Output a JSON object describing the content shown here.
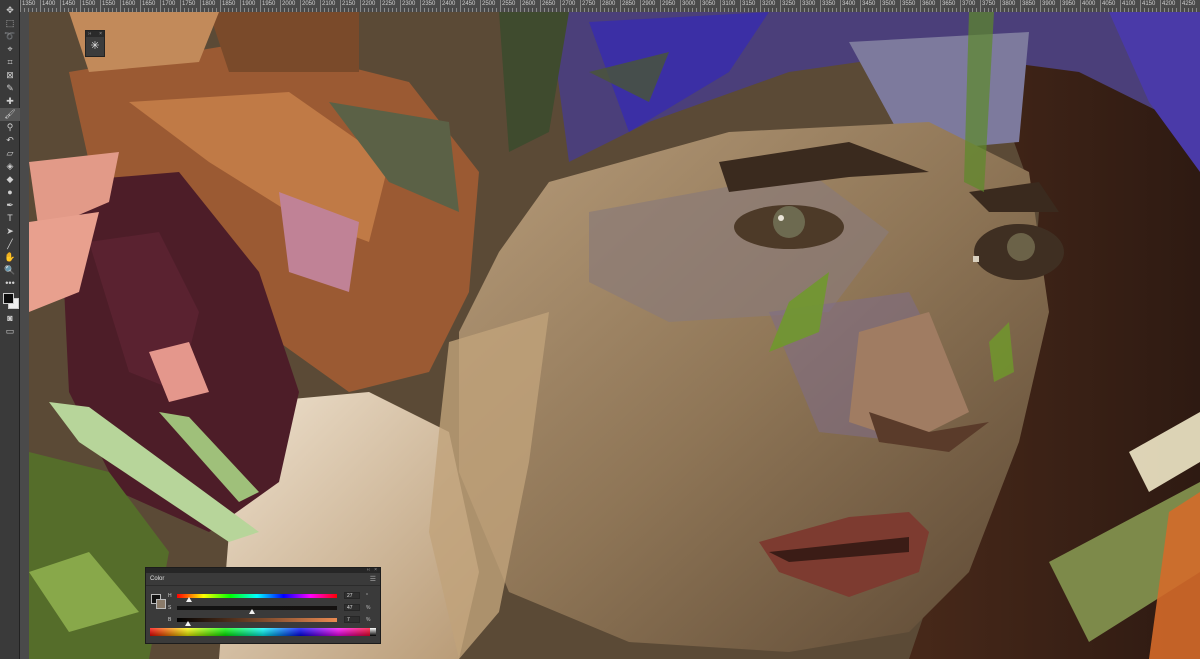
{
  "ruler": {
    "labels": [
      "1350",
      "1400",
      "1450",
      "1500",
      "1550",
      "1600",
      "1650",
      "1700",
      "1750",
      "1800",
      "1850",
      "1900",
      "1950",
      "2000",
      "2050",
      "2100",
      "2150",
      "2200",
      "2250",
      "2300",
      "2350",
      "2400",
      "2450",
      "2500",
      "2550",
      "2600",
      "2650",
      "2700",
      "2750",
      "2800",
      "2850",
      "2900",
      "2950",
      "3000",
      "3050",
      "3100",
      "3150",
      "3200",
      "3250",
      "3300",
      "3350",
      "3400",
      "3450",
      "3500",
      "3550",
      "3600",
      "3650",
      "3700",
      "3750",
      "3800",
      "3850",
      "3900",
      "3950",
      "4000",
      "4050",
      "4100",
      "4150",
      "4200",
      "4250"
    ]
  },
  "toolbar": {
    "tools": [
      {
        "name": "move-tool-icon",
        "glyph": "✥"
      },
      {
        "name": "marquee-tool-icon",
        "glyph": "⬚"
      },
      {
        "name": "lasso-tool-icon",
        "glyph": "➰"
      },
      {
        "name": "quick-select-tool-icon",
        "glyph": "⌖"
      },
      {
        "name": "crop-tool-icon",
        "glyph": "⌗"
      },
      {
        "name": "frame-tool-icon",
        "glyph": "⊠"
      },
      {
        "name": "eyedropper-tool-icon",
        "glyph": "✎"
      },
      {
        "name": "healing-brush-tool-icon",
        "glyph": "✚"
      },
      {
        "name": "brush-tool-icon",
        "glyph": "🖌",
        "active": true
      },
      {
        "name": "clone-stamp-tool-icon",
        "glyph": "⚲"
      },
      {
        "name": "history-brush-tool-icon",
        "glyph": "↶"
      },
      {
        "name": "eraser-tool-icon",
        "glyph": "▱"
      },
      {
        "name": "paint-bucket-tool-icon",
        "glyph": "◈"
      },
      {
        "name": "blur-tool-icon",
        "glyph": "◆"
      },
      {
        "name": "dodge-tool-icon",
        "glyph": "●"
      },
      {
        "name": "pen-tool-icon",
        "glyph": "✒"
      },
      {
        "name": "type-tool-icon",
        "glyph": "T"
      },
      {
        "name": "path-select-tool-icon",
        "glyph": "➤"
      },
      {
        "name": "line-tool-icon",
        "glyph": "╱"
      },
      {
        "name": "hand-tool-icon",
        "glyph": "✋"
      },
      {
        "name": "zoom-tool-icon",
        "glyph": "🔍"
      },
      {
        "name": "more-tools-icon",
        "glyph": "•••"
      }
    ],
    "bottom_tools": [
      {
        "name": "quick-mask-icon",
        "glyph": "◙"
      },
      {
        "name": "screen-mode-icon",
        "glyph": "▭"
      }
    ],
    "foreground_color": "#0d0d0d",
    "background_color": "#efefef"
  },
  "mini_panel": {
    "icon": "✳",
    "collapse": "››",
    "close": "×"
  },
  "color_panel": {
    "title": "Color",
    "menu_icon": "☰",
    "collapse": "‹‹",
    "close": "×",
    "rows": [
      {
        "letter": "H",
        "value": "27",
        "unit": "°",
        "fraction": 0.075
      },
      {
        "letter": "S",
        "value": "47",
        "unit": "%",
        "fraction": 0.47
      },
      {
        "letter": "B",
        "value": "7",
        "unit": "%",
        "fraction": 0.07
      }
    ]
  }
}
